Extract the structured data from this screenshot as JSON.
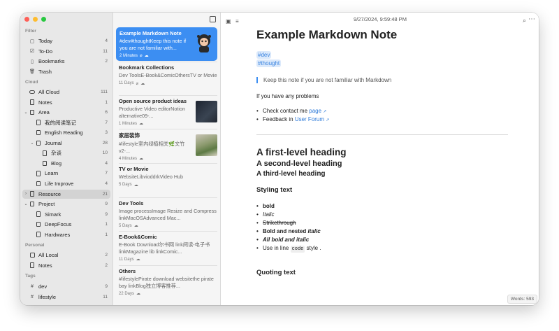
{
  "sidebar": {
    "filter_label": "Filter",
    "filter": [
      {
        "label": "Today",
        "count": "4",
        "icon": "calendar-icon"
      },
      {
        "label": "To-Do",
        "count": "11",
        "icon": "checkbox-icon"
      },
      {
        "label": "Bookmarks",
        "count": "2",
        "icon": "bookmark-icon"
      },
      {
        "label": "Trash",
        "count": "",
        "icon": "trash-icon"
      }
    ],
    "cloud_label": "Cloud",
    "cloud": [
      {
        "label": "All Cloud",
        "count": "111",
        "depth": 0,
        "chev": ""
      },
      {
        "label": "Notes",
        "count": "1",
        "depth": 0,
        "chev": ""
      },
      {
        "label": "Area",
        "count": "6",
        "depth": 0,
        "chev": "⌄"
      },
      {
        "label": "我的阅读笔记",
        "count": "7",
        "depth": 1,
        "chev": ""
      },
      {
        "label": "English Reading",
        "count": "3",
        "depth": 1,
        "chev": ""
      },
      {
        "label": "Journal",
        "count": "28",
        "depth": 1,
        "chev": "⌄"
      },
      {
        "label": "杂谈",
        "count": "10",
        "depth": 2,
        "chev": ""
      },
      {
        "label": "Blog",
        "count": "4",
        "depth": 2,
        "chev": ""
      },
      {
        "label": "Learn",
        "count": "7",
        "depth": 1,
        "chev": ""
      },
      {
        "label": "Life Improve",
        "count": "4",
        "depth": 1,
        "chev": ""
      },
      {
        "label": "Resource",
        "count": "21",
        "depth": 0,
        "chev": "›",
        "active": true
      },
      {
        "label": "Project",
        "count": "9",
        "depth": 0,
        "chev": "⌄"
      },
      {
        "label": "Simark",
        "count": "9",
        "depth": 1,
        "chev": ""
      },
      {
        "label": "DeepFocus",
        "count": "1",
        "depth": 1,
        "chev": ""
      },
      {
        "label": "Hardwares",
        "count": "1",
        "depth": 1,
        "chev": ""
      }
    ],
    "personal_label": "Personal",
    "personal": [
      {
        "label": "All Local",
        "count": "2"
      },
      {
        "label": "Notes",
        "count": "2"
      }
    ],
    "tags_label": "Tags",
    "tags": [
      {
        "label": "dev",
        "count": "9"
      },
      {
        "label": "lifestyle",
        "count": "11"
      }
    ]
  },
  "notes": [
    {
      "title": "Example Markdown Note",
      "summary": "#dev#thoughtKeep this note if you are not familiar with...",
      "meta": "2 Minutes",
      "selected": true,
      "thumb": "avatar"
    },
    {
      "title": "Bookmark Collections",
      "summary": "Dev ToolsE-Book&ComicOthersTV or Movie",
      "meta": "11 Days"
    },
    {
      "title": "Open source product ideas",
      "summary": "Productive Video editorNotion alternative09-...",
      "meta": "1 Minutes",
      "thumb": "dark"
    },
    {
      "title": "家居装饰",
      "summary": "#lifestyle室内绿植相关🌿文竹 v2-...",
      "meta": "4 Minutes",
      "thumb": "plant"
    },
    {
      "title": "TV or Movie",
      "summary": "WebsiteLibvioddrkVideo Hub",
      "meta": "5 Days"
    },
    {
      "title": "Dev Tools",
      "summary": "Image processImage Resize and Compress linkMacOSAdvanced Mac...",
      "meta": "5 Days"
    },
    {
      "title": "E-Book&Comic",
      "summary": "E-Book Download尔书网 link阅读-电子书 linkMagazine lib linkComic...",
      "meta": "11 Days"
    },
    {
      "title": "Others",
      "summary": "#lifestylePirate download websitethe pirate bay linkBlog独立博客推荐...",
      "meta": "22 Days"
    }
  ],
  "editor": {
    "datetime": "9/27/2024, 9:59:48 PM",
    "title": "Example Markdown Note",
    "tags": [
      "#dev",
      "#thought"
    ],
    "quote": "Keep this note if you are not familiar with Markdown",
    "problems": "If you have any problems",
    "contact_prefix": "Check contact me ",
    "contact_link": "page",
    "feedback_prefix": "Feedback in ",
    "feedback_link": "User Forum",
    "h1": "A first-level heading",
    "h2": "A second-level heading",
    "h3": "A third-level heading",
    "styling": "Styling text",
    "bold": "bold",
    "italic": "Italic",
    "strike": "Strikethrough",
    "bold_nested_prefix": "Bold and nested ",
    "bold_nested_italic": "italic",
    "all_bold_italic": "All bold and italic",
    "inline_prefix": "Use in line ",
    "inline_code": "code",
    "inline_suffix": " style .",
    "quoting": "Quoting text",
    "words": "Words: 593"
  }
}
